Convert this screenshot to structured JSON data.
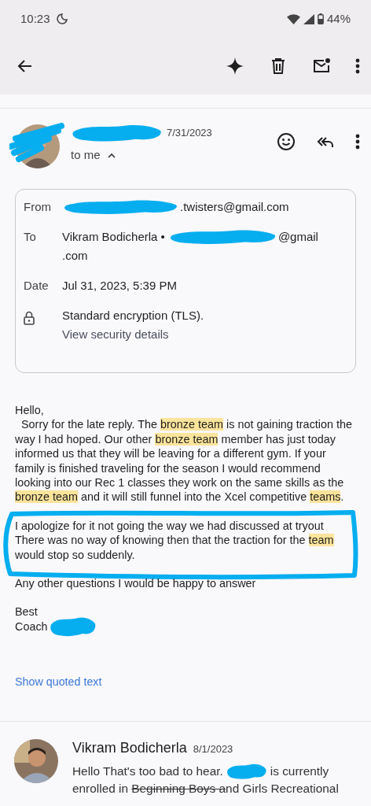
{
  "status_bar": {
    "time": "10:23",
    "battery": "44%"
  },
  "message": {
    "date": "7/31/2023",
    "recipient_summary": "to me",
    "details_expanded": true,
    "details": [
      {
        "kind": "from",
        "label": "From",
        "lines": [
          ".twisters@gmail.com"
        ]
      },
      {
        "kind": "to",
        "label": "To",
        "name": "Vikram Bodicherla •",
        "lines": [
          "@gmail",
          ".com"
        ]
      },
      {
        "kind": "date",
        "label": "Date",
        "lines": [
          "Jul 31, 2023, 5:39 PM"
        ]
      },
      {
        "kind": "security",
        "lines": [
          "Standard encryption (TLS)."
        ],
        "link": "View security details"
      }
    ],
    "body": [
      {
        "circled": false,
        "signature_redacted": false,
        "segments": [
          {
            "text": "Hello,\n  Sorry for the late reply. The ",
            "highlighted": false
          },
          {
            "text": "bronze team",
            "highlighted": true
          },
          {
            "text": " is not gaining traction the way I had hoped. Our other ",
            "highlighted": false
          },
          {
            "text": "bronze team",
            "highlighted": true
          },
          {
            "text": " member has just today informed us that they will be leaving for a different gym. If your family is finished traveling for the season I would recommend looking into our Rec 1 classes they work on the same skills as the ",
            "highlighted": false
          },
          {
            "text": "bronze team",
            "highlighted": true
          },
          {
            "text": " and it will still funnel into the Xcel competitive ",
            "highlighted": false
          },
          {
            "text": "teams",
            "highlighted": true
          },
          {
            "text": ".",
            "highlighted": false
          }
        ]
      },
      {
        "circled": true,
        "signature_redacted": false,
        "segments": [
          {
            "text": "I apologize for it not going the way we had discussed at tryout\nThere was no way of knowing then that the traction for the ",
            "highlighted": false
          },
          {
            "text": "team",
            "highlighted": true
          },
          {
            "text": " would stop so suddenly.",
            "highlighted": false
          }
        ]
      },
      {
        "circled": false,
        "signature_redacted": false,
        "segments": [
          {
            "text": "Any other questions I would be happy to answer",
            "highlighted": false
          }
        ]
      },
      {
        "circled": false,
        "signature_redacted": true,
        "segments": [
          {
            "text": "Best\nCoach",
            "highlighted": false
          }
        ]
      }
    ],
    "show_quoted": "Show quoted text"
  },
  "next_message": {
    "sender": "Vikram Bodicherla",
    "date": "8/1/2023",
    "snippet_lines": [
      [
        {
          "kind": "text",
          "text": "Hello That's too bad to hear."
        },
        {
          "kind": "redaction"
        },
        {
          "kind": "text",
          "text": "is currently"
        }
      ],
      [
        {
          "kind": "text",
          "text": "enrolled in "
        },
        {
          "kind": "struck",
          "text": "Beginning Boys a"
        },
        {
          "kind": "text",
          "text": "nd Girls Recreational"
        }
      ]
    ]
  }
}
